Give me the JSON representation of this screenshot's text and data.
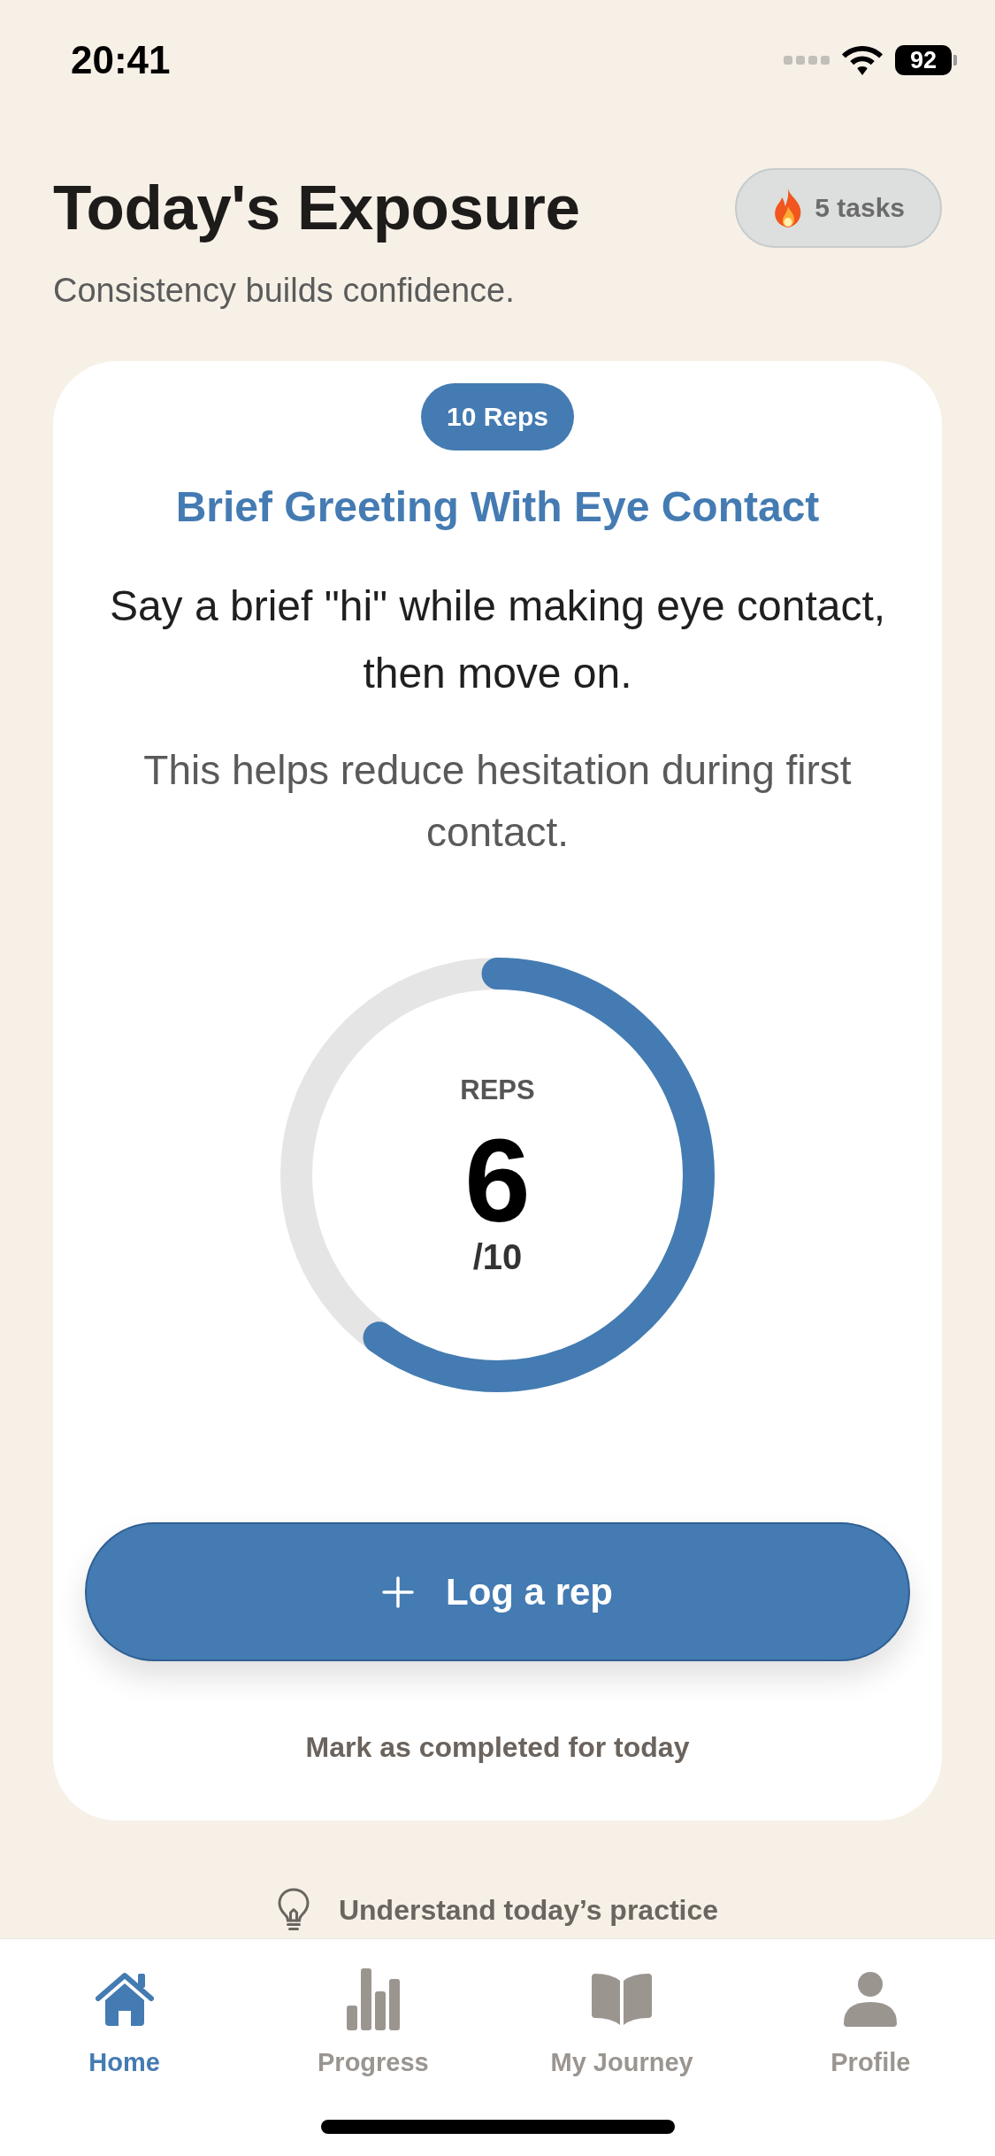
{
  "status_bar": {
    "time": "20:41",
    "battery": "92"
  },
  "header": {
    "title": "Today's Exposure",
    "subtitle": "Consistency builds confidence.",
    "tasks_badge": "5 tasks"
  },
  "exercise_card": {
    "badge": "10 Reps",
    "title": "Brief Greeting With Eye Contact",
    "instruction": "Say a brief \"hi\" while making eye contact, then move on.",
    "rationale": "This helps reduce hesitation during first contact.",
    "counter": {
      "label": "REPS",
      "value": "6",
      "target": "/10",
      "level": 0.6
    },
    "log_button": "Log a rep",
    "complete_link": "Mark as completed for today"
  },
  "practice_link": "Understand today’s practice",
  "tab_bar": {
    "tabs": [
      {
        "label": "Home",
        "selected": true
      },
      {
        "label": "Progress",
        "selected": false
      },
      {
        "label": "My Journey",
        "selected": false
      },
      {
        "label": "Profile",
        "selected": false
      }
    ]
  }
}
